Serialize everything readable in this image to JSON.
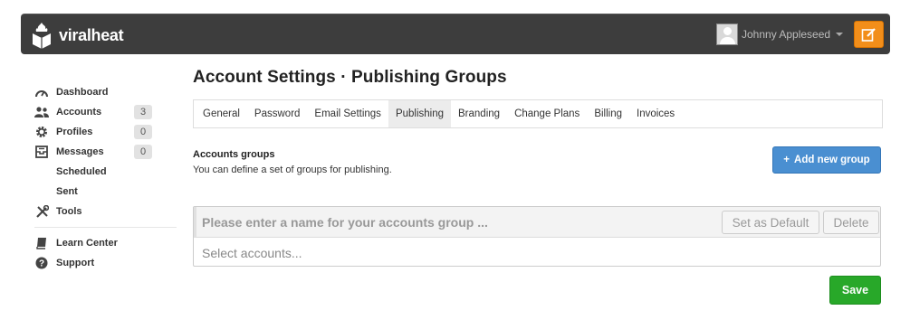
{
  "header": {
    "brand": "viralheat",
    "user_name": "Johnny Appleseed",
    "brand_color": "#3d3d3d",
    "accent_color": "#f28e1a"
  },
  "sidebar": {
    "items": [
      {
        "label": "Dashboard",
        "icon": "dashboard-icon"
      },
      {
        "label": "Accounts",
        "icon": "users-icon",
        "badge": "3"
      },
      {
        "label": "Profiles",
        "icon": "gear-icon",
        "badge": "0"
      },
      {
        "label": "Messages",
        "icon": "inbox-icon",
        "badge": "0"
      },
      {
        "label": "Scheduled"
      },
      {
        "label": "Sent"
      },
      {
        "label": "Tools",
        "icon": "tools-icon"
      },
      {
        "label": "Learn Center",
        "icon": "book-icon"
      },
      {
        "label": "Support",
        "icon": "help-icon"
      }
    ]
  },
  "main": {
    "title": "Account Settings · Publishing Groups",
    "tabs": [
      "General",
      "Password",
      "Email Settings",
      "Publishing",
      "Branding",
      "Change Plans",
      "Billing",
      "Invoices"
    ],
    "active_tab": "Publishing",
    "section_title": "Accounts groups",
    "section_desc": "You can define a set of groups for publishing.",
    "add_button": "Add new group",
    "group": {
      "name_placeholder": "Please enter a name for your accounts group ...",
      "set_default": "Set as Default",
      "delete": "Delete",
      "accounts_placeholder": "Select accounts..."
    },
    "save_button": "Save",
    "primary_color": "#4a8fd1",
    "success_color": "#28a829"
  }
}
